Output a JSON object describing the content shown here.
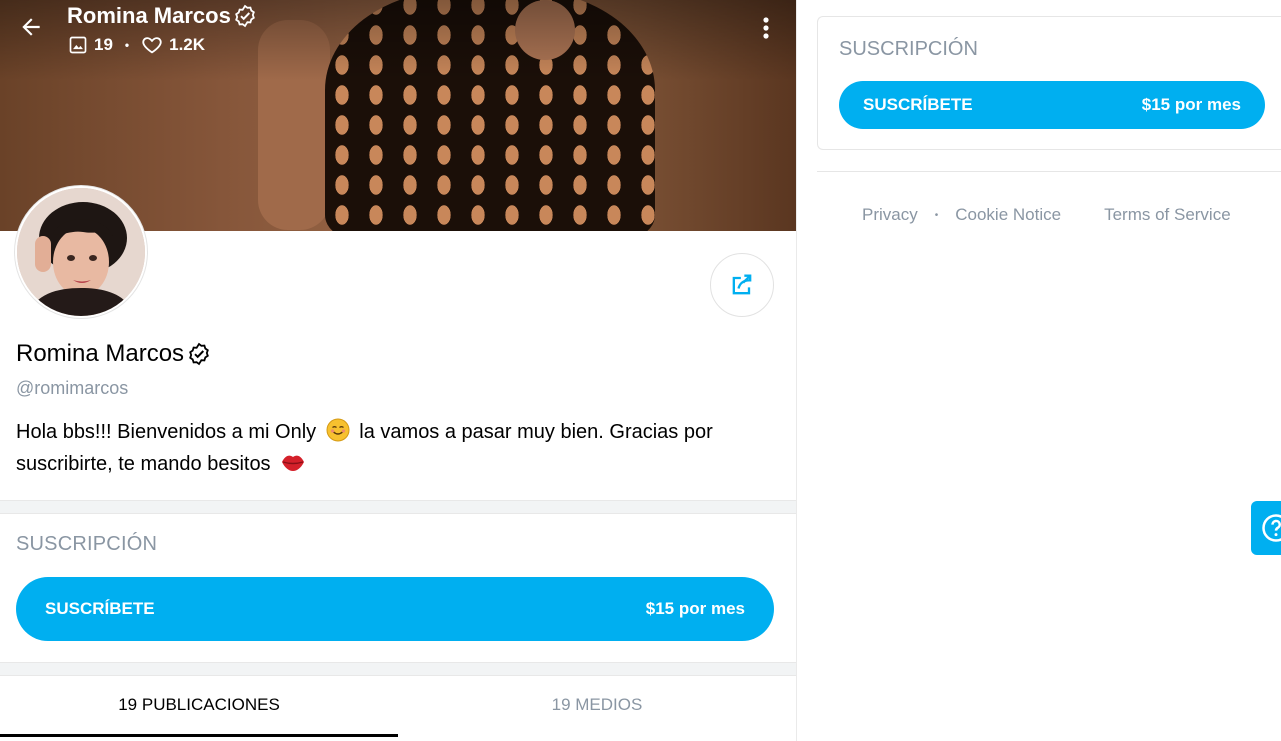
{
  "header": {
    "name": "Romina Marcos",
    "posts_count": "19",
    "likes_count": "1.2K"
  },
  "profile": {
    "name": "Romina Marcos",
    "handle": "@romimarcos",
    "bio_part1": "Hola bbs!!! Bienvenidos a mi Only",
    "bio_part2": "la vamos a pasar muy bien. Gracias por suscribirte, te mando besitos",
    "emoji_1": "smiling-face-icon",
    "emoji_2": "kiss-lips-icon"
  },
  "subscription": {
    "title": "SUSCRIPCIÓN",
    "button_label": "SUSCRÍBETE",
    "price": "$15 por mes"
  },
  "tabs": [
    {
      "label": "19 PUBLICACIONES",
      "active": true
    },
    {
      "label": "19 MEDIOS",
      "active": false
    }
  ],
  "sidebar": {
    "title": "SUSCRIPCIÓN",
    "button_label": "SUSCRÍBETE",
    "price": "$15 por mes"
  },
  "footer": {
    "links": [
      "Privacy",
      "Cookie Notice",
      "Terms of Service"
    ]
  },
  "colors": {
    "accent": "#00aff0",
    "muted": "#8a96a3"
  }
}
